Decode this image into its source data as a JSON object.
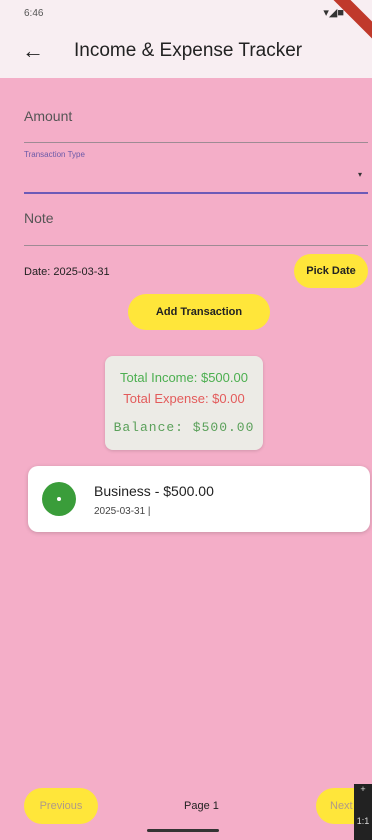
{
  "status_bar": {
    "time": "6:46",
    "indicators": "▾◢■"
  },
  "app_bar": {
    "back_icon": "arrow-left",
    "title": "Income & Expense Tracker"
  },
  "form": {
    "amount_label": "Amount",
    "transaction_type_label": "Transaction Type",
    "transaction_type_value": "",
    "dropdown_icon": "▾",
    "note_label": "Note",
    "date_text": "Date: 2025-03-31",
    "pick_date_label": "Pick Date",
    "add_transaction_label": "Add Transaction"
  },
  "summary": {
    "total_income": "Total Income: $500.00",
    "total_expense": "Total Expense: $0.00",
    "balance": "Balance: $500.00"
  },
  "transactions": [
    {
      "title": "Business - $500.00",
      "subtitle": "2025-03-31 |",
      "icon_color": "#3a9d3a"
    }
  ],
  "pagination": {
    "previous_label": "Previous",
    "page_label": "Page 1",
    "next_label": "Next"
  },
  "side_strip": {
    "plus": "+",
    "value": "1:1"
  },
  "colors": {
    "background": "#f4aec8",
    "appbar": "#f8eef2",
    "button": "#ffe63a",
    "income": "#4caf50",
    "expense": "#e35b5b",
    "accent_underline": "#6c5ab7"
  }
}
